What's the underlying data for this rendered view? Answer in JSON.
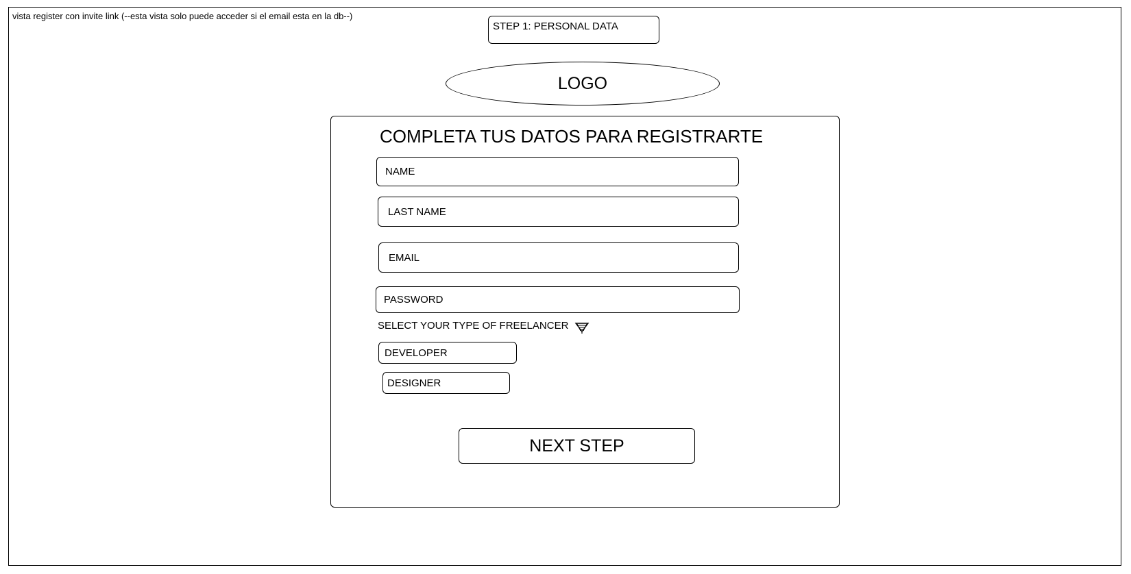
{
  "caption": "vista register con invite link (--esta vista solo puede acceder si el email esta en la db--)",
  "step_label": "STEP 1: PERSONAL DATA",
  "logo_label": "LOGO",
  "form": {
    "title": "COMPLETA TUS DATOS PARA REGISTRARTE",
    "fields": {
      "name": "NAME",
      "last_name": "LAST NAME",
      "email": "EMAIL",
      "password": "PASSWORD"
    },
    "freelancer_select": {
      "label": "SELECT YOUR TYPE OF FREELANCER",
      "icon": "chevron-down-icon",
      "options": [
        "DEVELOPER",
        "DESIGNER"
      ]
    },
    "next_button": "NEXT STEP"
  },
  "colors": {
    "stroke": "#000000",
    "background": "#ffffff"
  }
}
